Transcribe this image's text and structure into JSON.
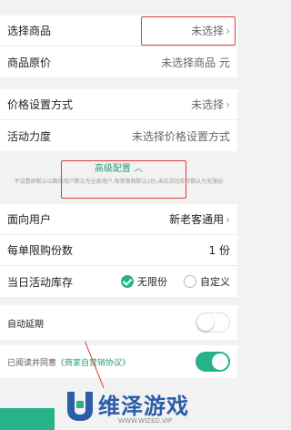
{
  "basic": {
    "product_label": "选择商品",
    "product_value": "未选择",
    "original_price_label": "商品原价",
    "original_price_value": "未选择商品 元"
  },
  "price": {
    "method_label": "价格设置方式",
    "method_value": "未选择",
    "strength_label": "活动力度",
    "strength_value": "未选择价格设置方式"
  },
  "advanced": {
    "title": "高级配置",
    "description": "不设置即默认以面向用户默认为全部用户,每单限购默认1份,当日活动库存默认为无限份"
  },
  "config": {
    "audience_label": "面向用户",
    "audience_value": "新老客通用",
    "limit_label": "每单限购份数",
    "limit_value": "1 份",
    "stock_label": "当日活动库存",
    "stock_opt1": "无限份",
    "stock_opt2": "自定义"
  },
  "auto_extend": {
    "label": "自动延期",
    "on": false
  },
  "agreement": {
    "prefix": "已阅读并同意",
    "link": "《商家自营销协议》",
    "on": true
  },
  "watermark": {
    "brand": "维泽游戏",
    "url": "WWW.WIZED.VIP"
  },
  "colors": {
    "accent": "#26b38a",
    "highlight": "#e03a3a",
    "brand_blue": "#2b5da8"
  }
}
